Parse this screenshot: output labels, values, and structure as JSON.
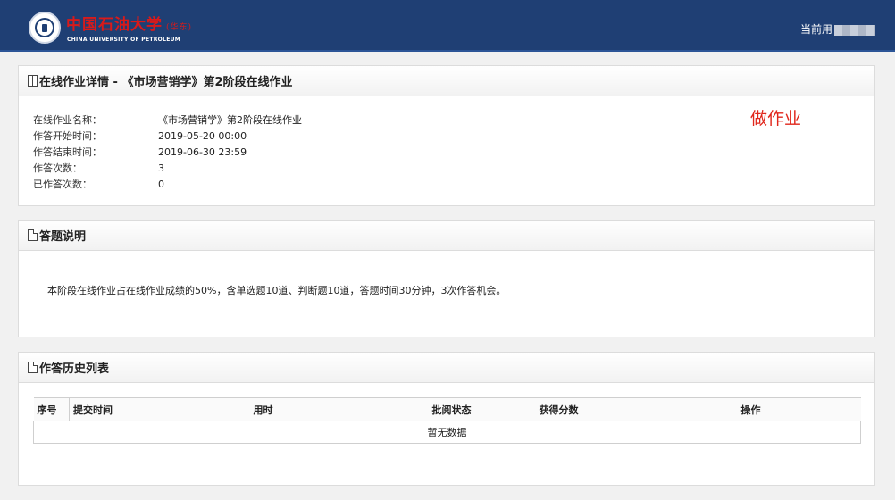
{
  "header": {
    "brand_cn": "中国石油大学",
    "brand_cn_sub": "(华东)",
    "brand_en": "CHINA UNIVERSITY OF PETROLEUM",
    "current_user_label": "当前用"
  },
  "details": {
    "title": "在线作业详情 - 《市场营销学》第2阶段在线作业",
    "rows": [
      {
        "label": "在线作业名称：",
        "value": "《市场营销学》第2阶段在线作业"
      },
      {
        "label": "作答开始时间：",
        "value": "2019-05-20 00:00"
      },
      {
        "label": "作答结束时间：",
        "value": "2019-06-30 23:59"
      },
      {
        "label": "作答次数：",
        "value": "3"
      },
      {
        "label": "已作答次数：",
        "value": "0"
      }
    ],
    "do_homework": "做作业"
  },
  "instructions": {
    "title": "答题说明",
    "text": "本阶段在线作业占在线作业成绩的50%，含单选题10道、判断题10道，答题时间30分钟，3次作答机会。"
  },
  "history": {
    "title": "作答历史列表",
    "columns": [
      "序号",
      "提交时间",
      "用时",
      "批阅状态",
      "获得分数",
      "操作"
    ],
    "empty_text": "暂无数据"
  },
  "colors": {
    "header_bg": "#1f3f74",
    "brand_red": "#d91a1a",
    "action_red": "#e0261b"
  }
}
